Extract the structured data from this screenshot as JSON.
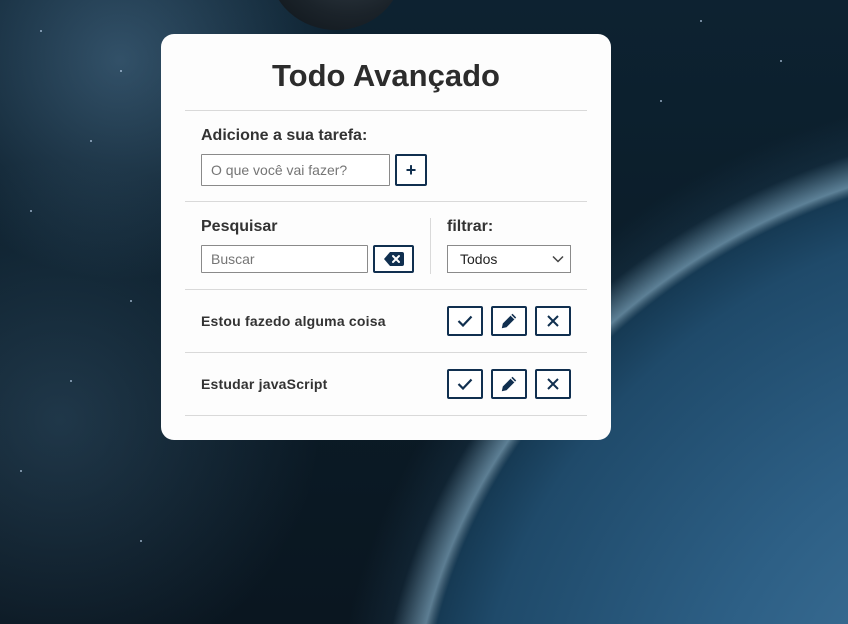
{
  "app": {
    "title": "Todo Avançado"
  },
  "add": {
    "label": "Adicione a sua tarefa:",
    "placeholder": "O que você vai fazer?",
    "value": "",
    "button_label": "+"
  },
  "search": {
    "label": "Pesquisar",
    "placeholder": "Buscar",
    "value": "",
    "clear_icon": "backspace-icon"
  },
  "filter": {
    "label": "filtrar:",
    "selected": "Todos"
  },
  "todos": [
    {
      "text": "Estou fazedo alguma coisa",
      "actions": [
        "check-icon",
        "pencil-icon",
        "close-icon"
      ]
    },
    {
      "text": "Estudar javaScript",
      "actions": [
        "check-icon",
        "pencil-icon",
        "close-icon"
      ]
    }
  ],
  "colors": {
    "accent": "#102f4f",
    "card_background": "#fdfdfd",
    "divider": "#d9d9d9"
  }
}
